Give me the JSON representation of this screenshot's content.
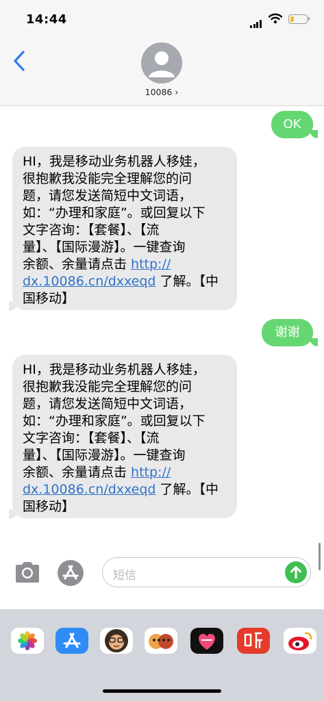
{
  "status": {
    "time": "14:44"
  },
  "header": {
    "contact": "10086 ›"
  },
  "messages": [
    {
      "dir": "out",
      "text": "OK"
    },
    {
      "dir": "in",
      "lines": [
        "HI，我是移动业务机器人移娃，",
        "很抱歉我没能完全理解您的问",
        "题，请您发送简短中文词语，",
        "如：“办理和家庭”。或回复以下",
        "文字咨询：【套餐】、【流",
        "量】、【国际漫游】。一键查询"
      ],
      "pre_link": "余额、余量请点击 ",
      "link_1": "http://",
      "link_2": "dx.10086.cn/dxxeqd",
      "post_link": " 了解。【中",
      "last_line": "国移动】"
    },
    {
      "dir": "out",
      "text": "谢谢"
    },
    {
      "dir": "in",
      "lines": [
        "HI，我是移动业务机器人移娃，",
        "很抱歉我没能完全理解您的问",
        "题，请您发送简短中文词语，",
        "如：“办理和家庭”。或回复以下",
        "文字咨询：【套餐】、【流",
        "量】、【国际漫游】。一键查询"
      ],
      "pre_link": "余额、余量请点击 ",
      "link_1": "http://",
      "link_2": "dx.10086.cn/dxxeqd",
      "post_link": " 了解。【中",
      "last_line": "国移动】"
    }
  ],
  "composer": {
    "placeholder": "短信"
  },
  "drawer": {
    "apps": [
      "photos-app",
      "app-store-app",
      "memoji-app",
      "animoji-app",
      "heart-app",
      "ting-app",
      "weibo-app"
    ]
  }
}
